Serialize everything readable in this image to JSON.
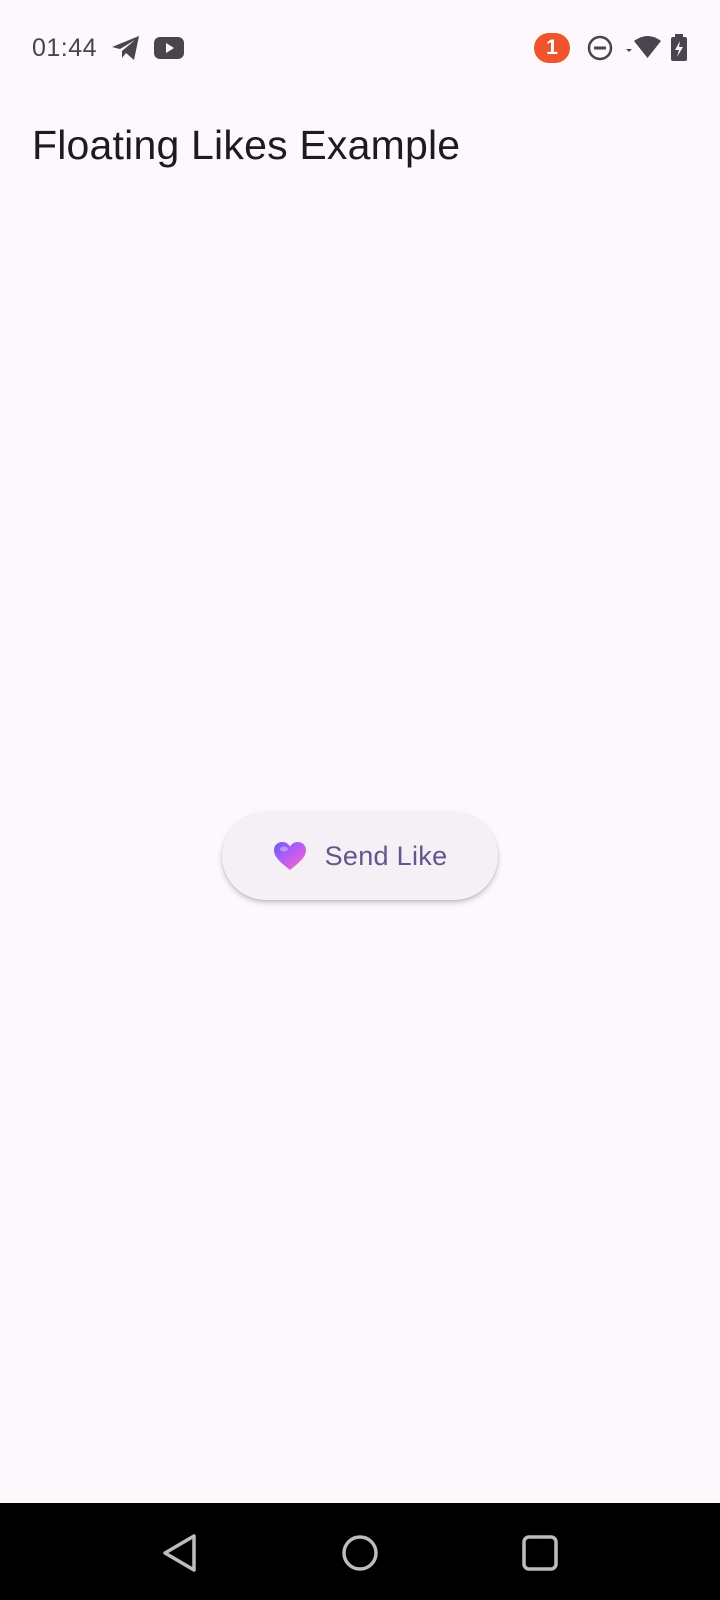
{
  "status_bar": {
    "time": "01:44",
    "notification_count": "1",
    "left_icons": [
      "telegram-icon",
      "youtube-icon"
    ],
    "right_icons": [
      "do-not-disturb-icon",
      "wifi-icon",
      "battery-charging-icon"
    ]
  },
  "app_bar": {
    "title": "Floating Likes Example"
  },
  "main": {
    "send_like_button": {
      "label": "Send Like",
      "icon": "heart-icon"
    }
  },
  "nav_bar": {
    "buttons": [
      "back-icon",
      "home-icon",
      "recents-icon"
    ]
  },
  "colors": {
    "background": "#fcf8fc",
    "button_background": "#f5eff6",
    "button_text": "#65558f",
    "badge": "#f0542d",
    "heart_gradient": [
      "#6a5cff",
      "#ff5fb0"
    ],
    "nav_bar": "#000000"
  }
}
